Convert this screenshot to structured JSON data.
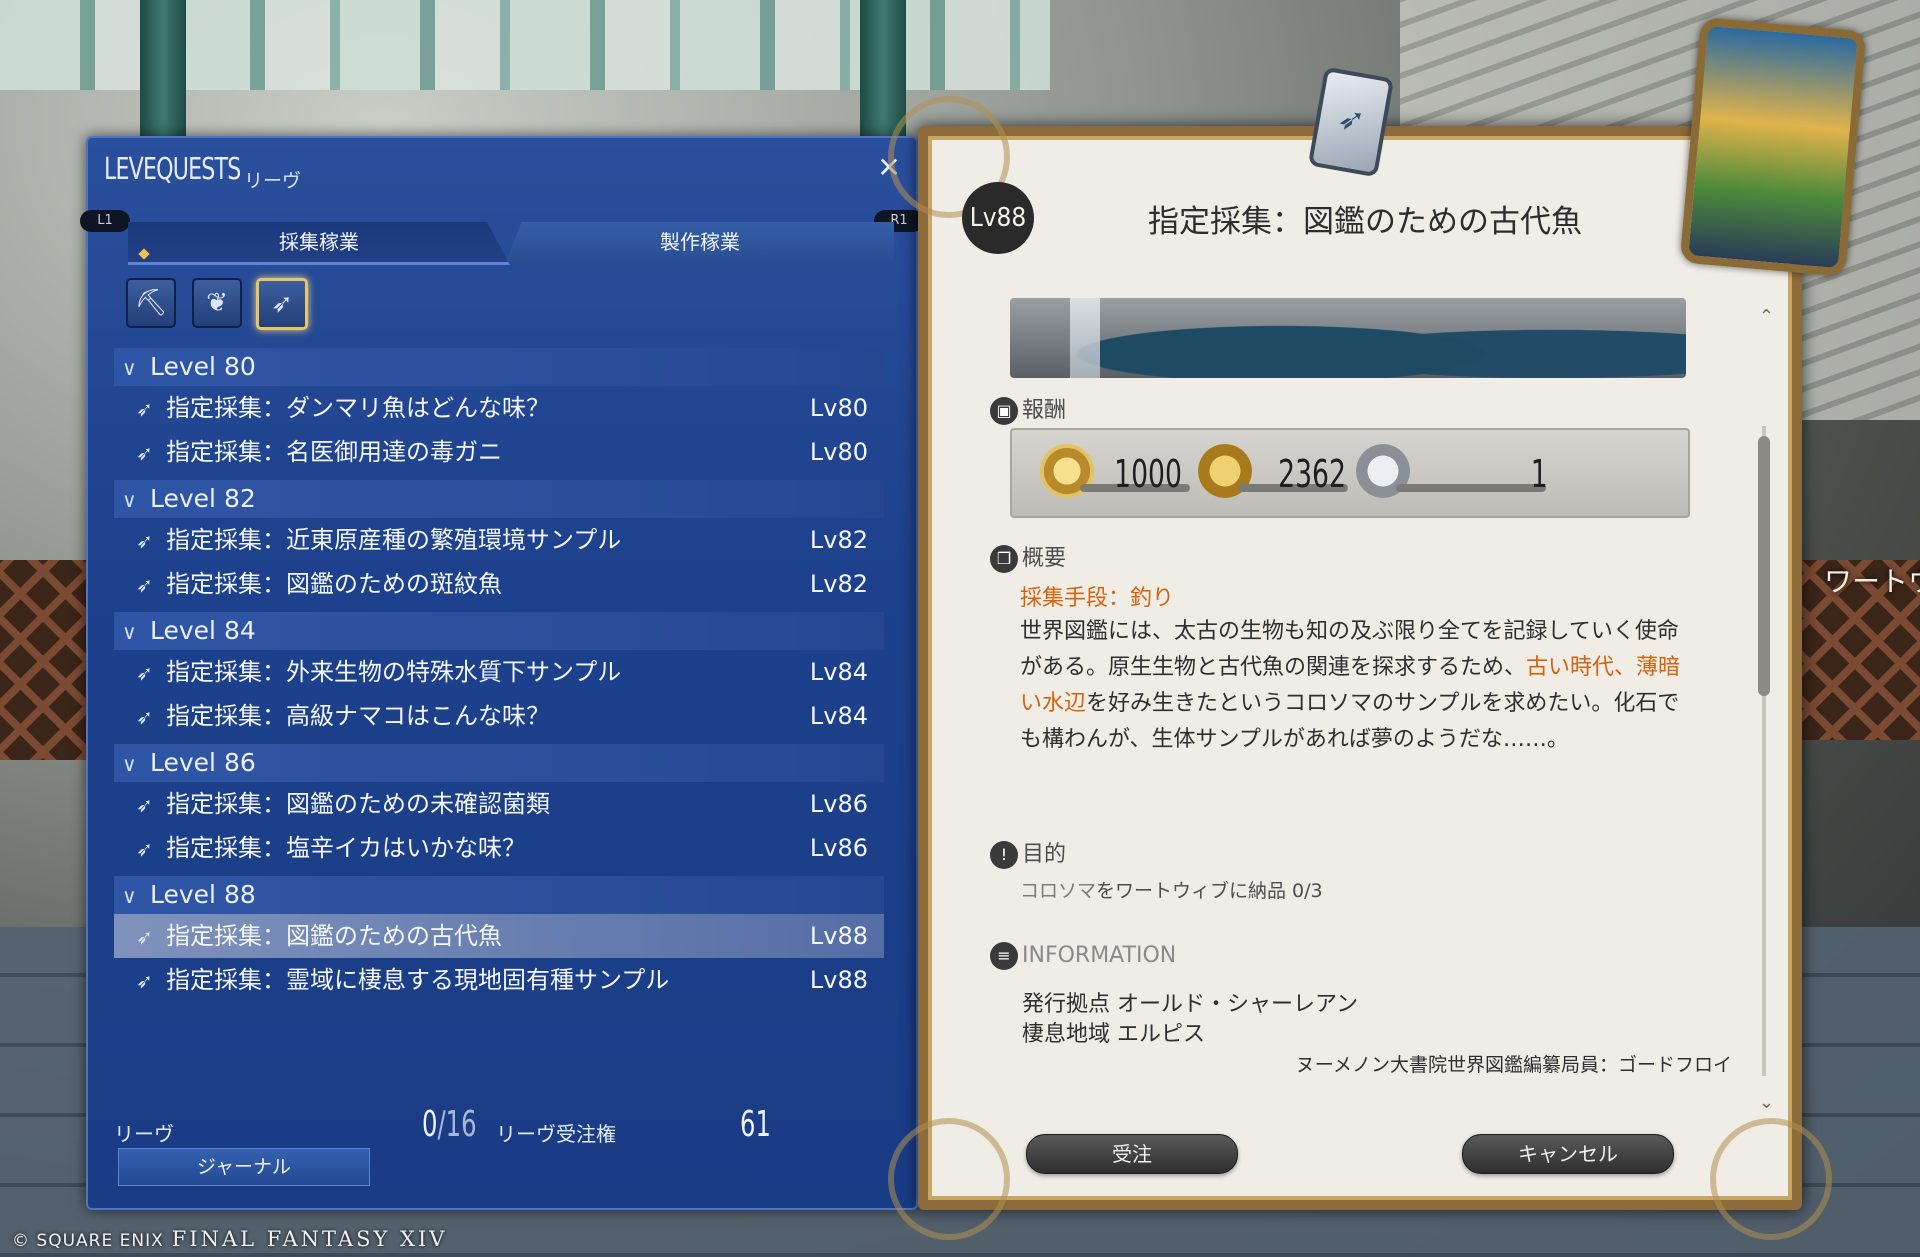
{
  "watermark": {
    "copyright": "© SQUARE ENIX",
    "game": "FINAL FANTASY XIV"
  },
  "background_sign": "ワートウィブ",
  "levequests": {
    "title": "LEVEQUESTS",
    "subtitle": "リーヴ",
    "close_icon": "close-icon",
    "shoulder_left": "L1",
    "shoulder_right": "R1",
    "tabs": [
      {
        "label": "採集稼業",
        "selected": true
      },
      {
        "label": "製作稼業",
        "selected": false
      }
    ],
    "job_filters": [
      {
        "name": "miner-pickaxe-icon",
        "glyph": "⛏",
        "selected": false
      },
      {
        "name": "botanist-leaf-icon",
        "glyph": "❦",
        "selected": false
      },
      {
        "name": "fisher-feather-icon",
        "glyph": "➶",
        "selected": true
      }
    ],
    "groups": [
      {
        "header": "Level 80",
        "items": [
          {
            "name": "指定採集：ダンマリ魚はどんな味？",
            "level": "Lv80"
          },
          {
            "name": "指定採集：名医御用達の毒ガニ",
            "level": "Lv80"
          }
        ]
      },
      {
        "header": "Level 82",
        "items": [
          {
            "name": "指定採集：近東原産種の繁殖環境サンプル",
            "level": "Lv82"
          },
          {
            "name": "指定採集：図鑑のための斑紋魚",
            "level": "Lv82"
          }
        ]
      },
      {
        "header": "Level 84",
        "items": [
          {
            "name": "指定採集：外来生物の特殊水質下サンプル",
            "level": "Lv84"
          },
          {
            "name": "指定採集：高級ナマコはこんな味？",
            "level": "Lv84"
          }
        ]
      },
      {
        "header": "Level 86",
        "items": [
          {
            "name": "指定採集：図鑑のための未確認菌類",
            "level": "Lv86"
          },
          {
            "name": "指定採集：塩辛イカはいかな味？",
            "level": "Lv86"
          }
        ]
      },
      {
        "header": "Level 88",
        "items": [
          {
            "name": "指定採集：図鑑のための古代魚",
            "level": "Lv88",
            "selected": true
          },
          {
            "name": "指定採集：霊域に棲息する現地固有種サンプル",
            "level": "Lv88"
          }
        ]
      }
    ],
    "footer": {
      "leves_label": "リーヴ",
      "leves_count": "0",
      "leves_max": "16",
      "allowance_label": "リーヴ受注権",
      "allowance_value": "61",
      "journal_button": "ジャーナル"
    }
  },
  "quest_detail": {
    "level_badge": "Lv88",
    "title": "指定採集：図鑑のための古代魚",
    "rewards_label": "報酬",
    "rewards": {
      "exp": "1000",
      "gil": "2362",
      "seals": "1"
    },
    "summary_label": "概要",
    "method": "採集手段：釣り",
    "description_part1": "世界図鑑には、太古の生物も知の及ぶ限り全てを記録していく使命がある。原生生物と古代魚の関連を探求するため、",
    "description_highlight": "古い時代、薄暗い水辺",
    "description_part2": "を好み生きたというコロソマのサンプルを求めたい。化石でも構わんが、生体サンプルがあれば夢のようだな……。",
    "objective_label": "目的",
    "objective_target": "コロソマ",
    "objective_rest": "をワートウィブに納品 0/3",
    "information_label": "INFORMATION",
    "issued_at": "発行拠点 オールド・シャーレアン",
    "habitat": "棲息地域 エルピス",
    "client": "ヌーメノン大書院世界図鑑編纂局員：ゴードフロイ",
    "accept_button": "受注",
    "cancel_button": "キャンセル"
  }
}
